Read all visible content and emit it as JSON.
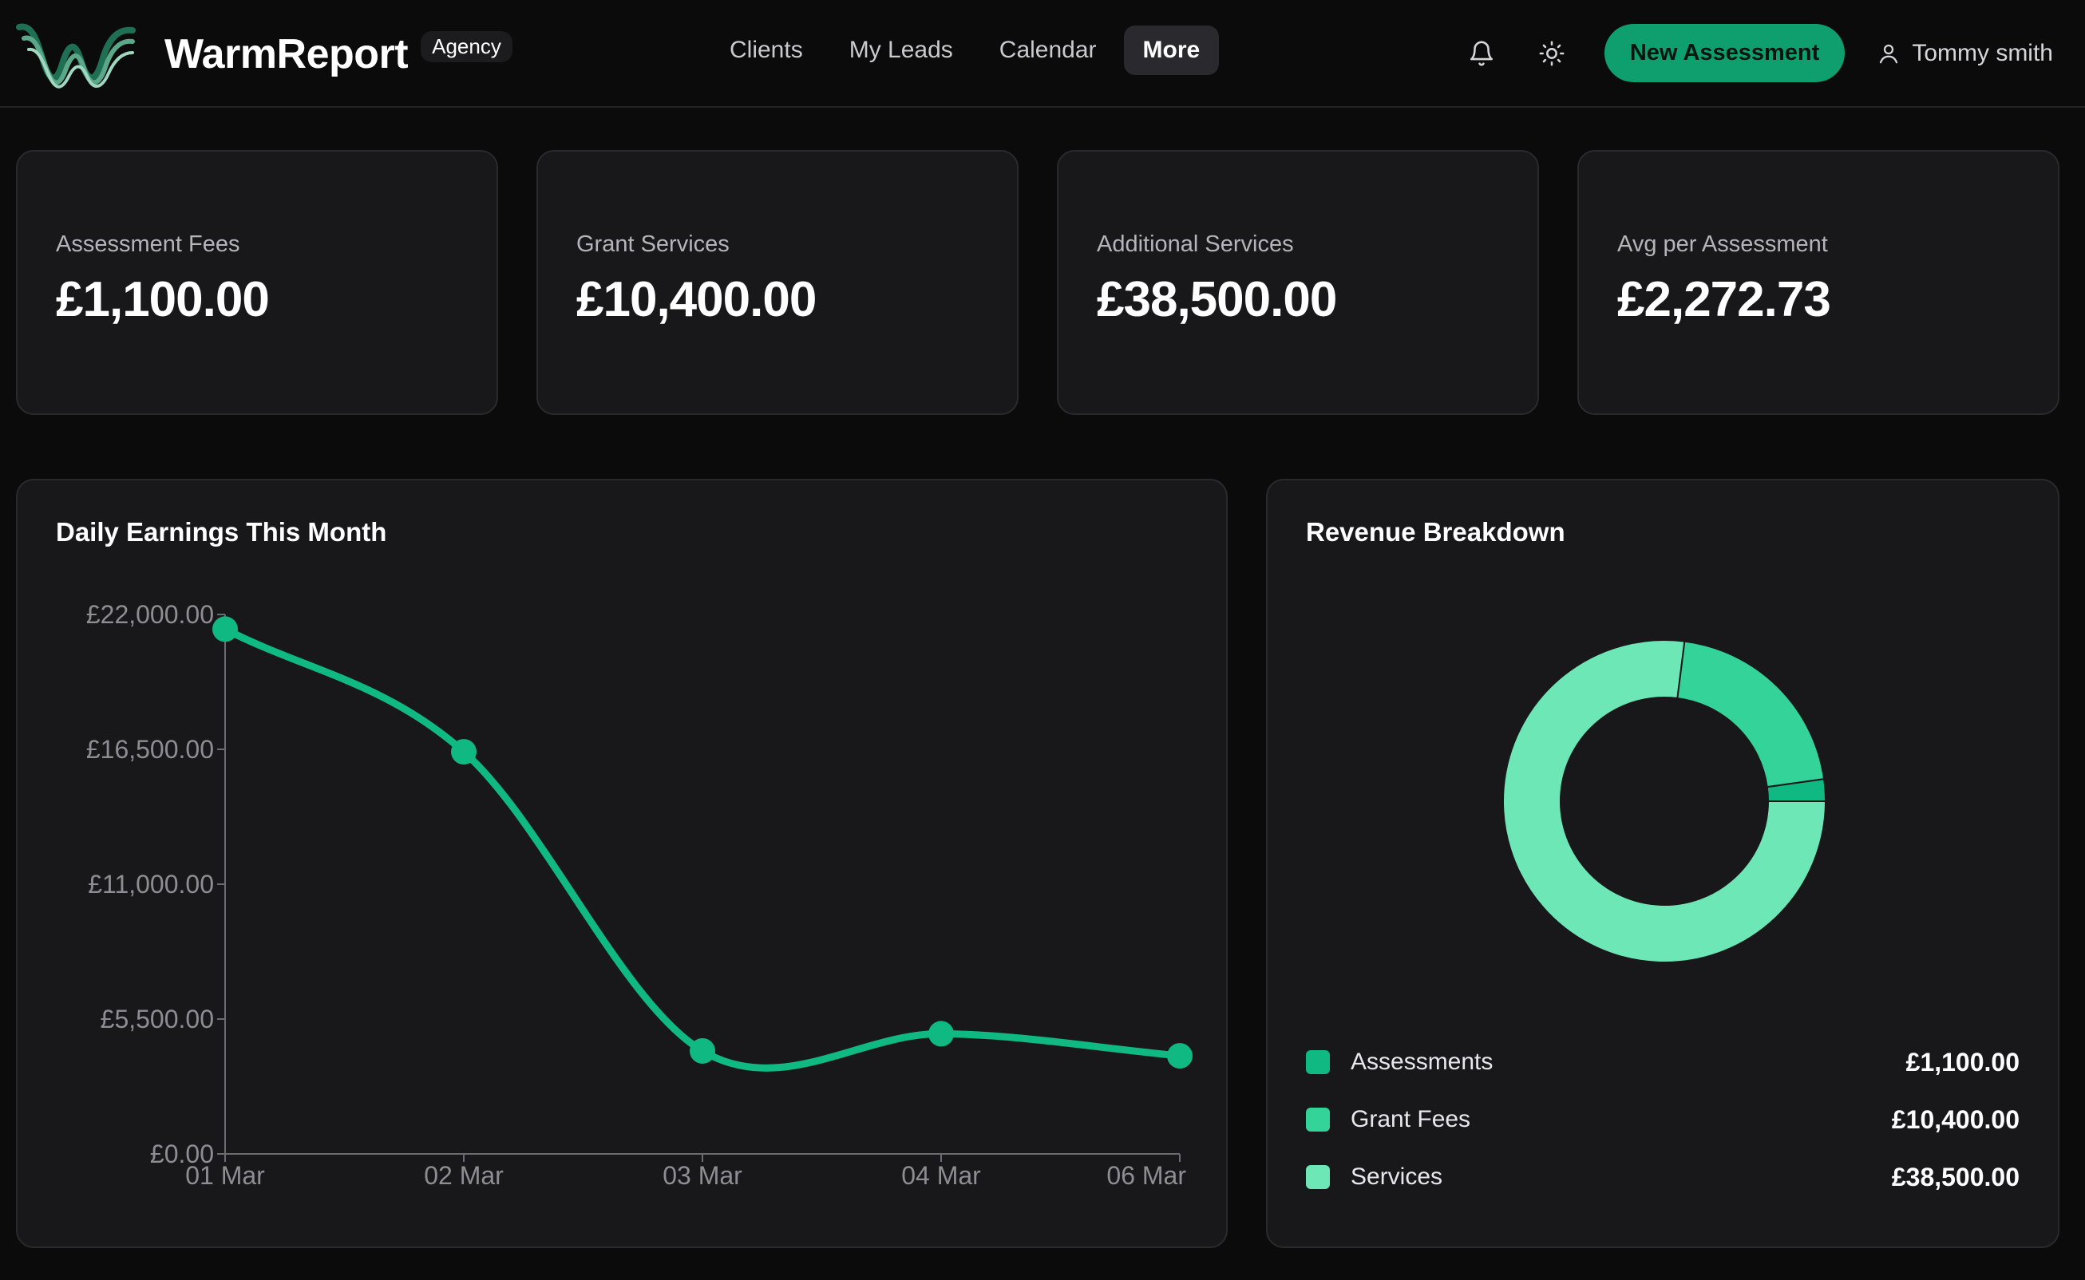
{
  "header": {
    "brand_name": "WarmReport",
    "badge": "Agency",
    "nav": [
      {
        "label": "Clients"
      },
      {
        "label": "My Leads"
      },
      {
        "label": "Calendar"
      },
      {
        "label": "More",
        "active": true
      }
    ],
    "icons": [
      "bell-icon",
      "sun-icon",
      "user-icon"
    ],
    "new_assessment_label": "New Assessment",
    "user_name": "Tommy smith"
  },
  "stats": [
    {
      "label": "Assessment Fees",
      "value": "£1,100.00"
    },
    {
      "label": "Grant Services",
      "value": "£10,400.00"
    },
    {
      "label": "Additional Services",
      "value": "£38,500.00"
    },
    {
      "label": "Avg per Assessment",
      "value": "£2,272.73"
    }
  ],
  "daily_panel": {
    "title": "Daily Earnings This Month"
  },
  "breakdown_panel": {
    "title": "Revenue Breakdown",
    "legend": [
      {
        "label": "Assessments",
        "amount": "£1,100.00"
      },
      {
        "label": "Grant Fees",
        "amount": "£10,400.00"
      },
      {
        "label": "Services",
        "amount": "£38,500.00"
      }
    ]
  },
  "colors": {
    "accent": "#0f9f6e",
    "line": "#10b981",
    "assessments": "#10b981",
    "grant_fees": "#34d399",
    "services": "#6ee7b7",
    "card_bg": "#18181b",
    "page_bg": "#0b0b0c"
  },
  "chart_data": [
    {
      "type": "line",
      "title": "Daily Earnings This Month",
      "x": [
        "01 Mar",
        "02 Mar",
        "03 Mar",
        "04 Mar",
        "06 Mar"
      ],
      "series": [
        {
          "values": [
            21400,
            16400,
            4200,
            4900,
            4000
          ]
        }
      ],
      "ylim": [
        0,
        22000
      ],
      "yticks": [
        0,
        5500,
        11000,
        16500,
        22000
      ],
      "ytick_labels": [
        "£0.00",
        "£5,500.00",
        "£11,000.00",
        "£16,500.00",
        "£22,000.00"
      ],
      "grid": false,
      "smooth": true
    },
    {
      "type": "pie",
      "title": "Revenue Breakdown",
      "donut": true,
      "categories": [
        "Assessments",
        "Grant Fees",
        "Services"
      ],
      "values": [
        1100,
        10400,
        38500
      ],
      "legend": "bottom"
    }
  ]
}
